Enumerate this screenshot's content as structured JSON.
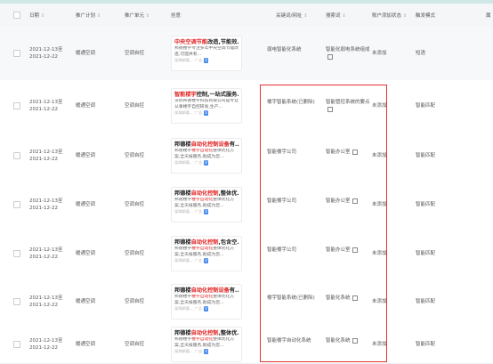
{
  "header": {
    "date": "日期",
    "plan": "推广计划",
    "unit": "推广单元",
    "creative": "创意",
    "keyword": "关键词/网址",
    "search_word": "搜索词",
    "status": "账户添加状态",
    "match_mode": "触发模式",
    "last": "属"
  },
  "rows": [
    {
      "date": "2021-12-13至2021-12-22",
      "plan": "暖通空调",
      "unit": "空调自控",
      "creative": {
        "title_pre": "",
        "title_hl": "中央空调节能",
        "title_post": "改造,节能效...",
        "desc_pre": "邦德楼宇",
        "desc_hl": "",
        "desc_post": "专注多年中央空调节能改造,可提供有...",
        "meta": "深圳邦德...",
        "ad": "广告",
        "v": "V"
      },
      "keyword": "弱电智能化系统",
      "search_word": "智能化弱电系统组成",
      "status": "未添加",
      "match": "短语"
    },
    {
      "date": "2021-12-13至2021-12-22",
      "plan": "暖通空调",
      "unit": "空调自控",
      "creative": {
        "title_pre": "",
        "title_hl": "智能楼宇",
        "title_post": "控制,一站式服务...",
        "desc_pre": "深圳邦德楼宇科技有限公司是专业从事",
        "desc_hl": "",
        "desc_post": "楼宇自控研发,生产...",
        "meta": "深圳邦德...",
        "ad": "广告",
        "v": "V"
      },
      "keyword": "楼宇智能系统(已删除)",
      "search_word": "智能管控系统的要点",
      "status": "未添加",
      "match": "智能匹配"
    },
    {
      "date": "2021-12-13至2021-12-22",
      "plan": "暖通空调",
      "unit": "空调自控",
      "creative": {
        "title_pre": "邦德楼",
        "title_hl": "自动化控制设备",
        "title_post": "有...",
        "desc_pre": "邦德楼宇",
        "desc_hl": "楼宇自动化",
        "desc_post": "整体优化方案,全天候服务,助成为您...",
        "meta": "深圳邦德...",
        "ad": "广告",
        "v": "V"
      },
      "keyword": "智能楼宇公司",
      "search_word": "智能办公室",
      "status": "未添加",
      "match": "智能匹配"
    },
    {
      "date": "2021-12-13至2021-12-22",
      "plan": "暖通空调",
      "unit": "空调自控",
      "creative": {
        "title_pre": "邦德楼",
        "title_hl": "自动化控制",
        "title_post": ",整体优...",
        "desc_pre": "邦德楼宇",
        "desc_hl": "楼宇自动化",
        "desc_post": "整体优化方案,全天候服务,助成为您...",
        "meta": "深圳邦德...",
        "ad": "广告",
        "v": "V"
      },
      "keyword": "智能楼宇公司",
      "search_word": "智能办公室",
      "status": "未添加",
      "match": "智能匹配"
    },
    {
      "date": "2021-12-13至2021-12-22",
      "plan": "暖通空调",
      "unit": "空调自控",
      "creative": {
        "title_pre": "邦德楼",
        "title_hl": "自动化控制",
        "title_post": ",包含空...",
        "desc_pre": "邦德楼宇",
        "desc_hl": "楼宇自动化",
        "desc_post": "整体优化方案,全天候服务,助成为您...",
        "meta": "深圳邦德...",
        "ad": "广告",
        "v": "V"
      },
      "keyword": "智能楼宇公司",
      "search_word": "智能办公室",
      "status": "未添加",
      "match": "智能匹配"
    },
    {
      "date": "2021-12-13至2021-12-22",
      "plan": "暖通空调",
      "unit": "空调自控",
      "creative": {
        "title_pre": "邦德楼",
        "title_hl": "自动化控制设备",
        "title_post": "有...",
        "desc_pre": "邦德楼宇",
        "desc_hl": "楼宇自动化",
        "desc_post": "整体优化方案,全天候服务,助成为您...",
        "meta": "深圳邦德...",
        "ad": "广告",
        "v": "V"
      },
      "keyword": "楼宇智能系统(已删除)",
      "search_word": "智能化系统",
      "status": "未添加",
      "match": "智能匹配"
    },
    {
      "date": "2021-12-13至2021-12-22",
      "plan": "暖通空调",
      "unit": "空调自控",
      "creative": {
        "title_pre": "邦德楼",
        "title_hl": "自动化控制",
        "title_post": ",整体优...",
        "desc_pre": "邦德楼宇",
        "desc_hl": "楼宇自动化",
        "desc_post": "整体优化方案,全天候服务,助成为您...",
        "meta": "深圳邦德...",
        "ad": "广告",
        "v": "V"
      },
      "keyword": "智能楼宇自动化系统",
      "search_word": "智能化系统",
      "status": "未添加",
      "match": "智能匹配"
    }
  ]
}
